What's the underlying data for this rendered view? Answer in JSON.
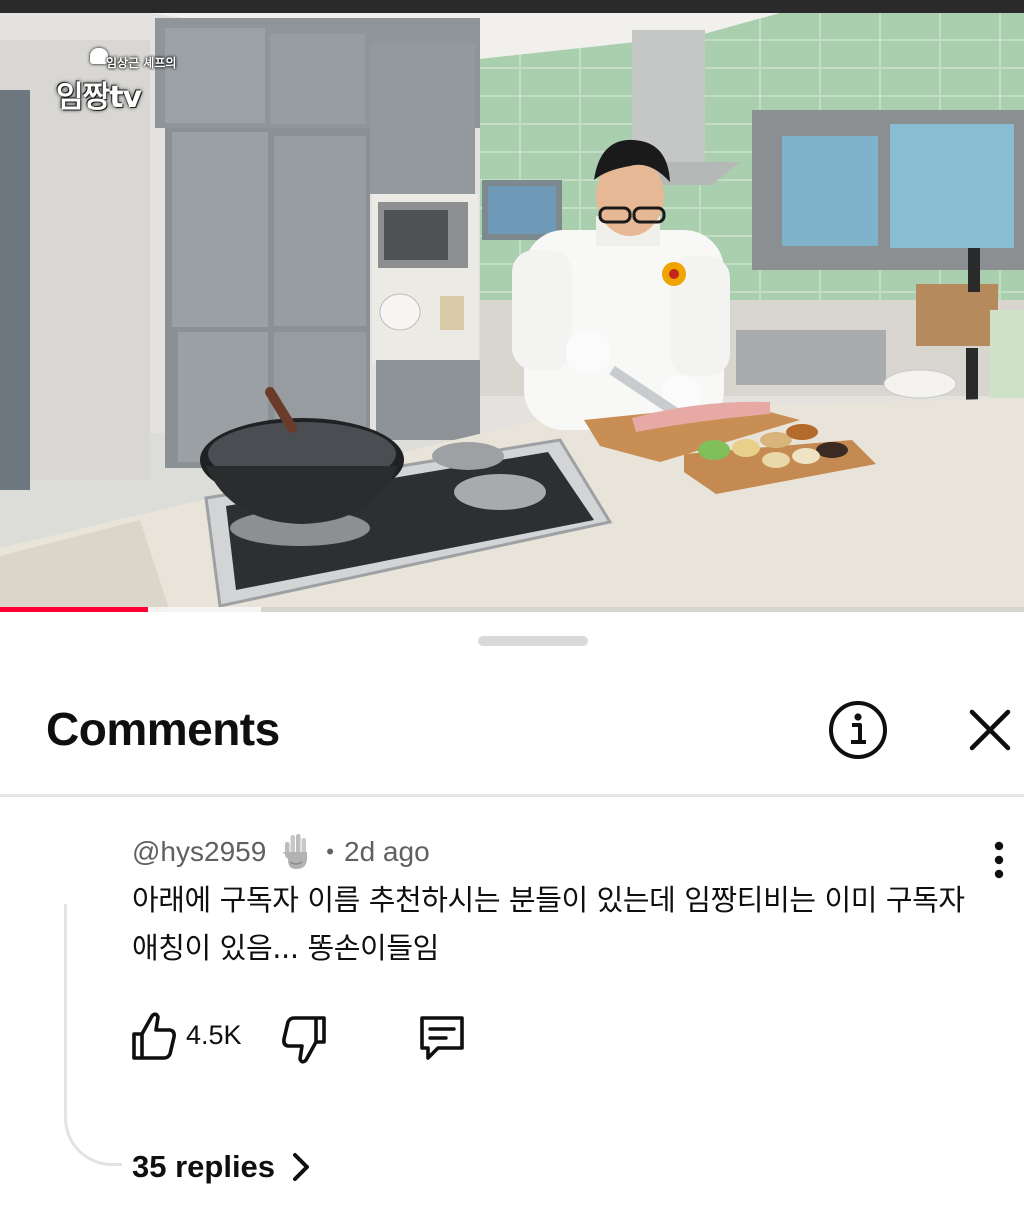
{
  "video": {
    "channel_logo_sub": "임상근 셰프의",
    "channel_logo_main": "임짱tv",
    "progress_percent": 14.5,
    "buffer_percent": 25.5,
    "colors": {
      "progress": "#ff0033"
    }
  },
  "sheet": {
    "title": "Comments",
    "info_icon": "info-circle-icon",
    "close_icon": "close-icon"
  },
  "comment": {
    "author": "@hys2959",
    "badge_icon": "raised-hand-icon",
    "separator": "•",
    "time": "2d ago",
    "text": "아래에 구독자 이름 추천하시는 분들이 있는데 임짱티비는 이미 구독자 애칭이 있음... 똥손이들임",
    "like_count": "4.5K",
    "like_icon": "thumbs-up-icon",
    "dislike_icon": "thumbs-down-icon",
    "reply_icon": "reply-comment-icon",
    "more_icon": "more-vertical-icon",
    "replies_label": "35 replies",
    "replies_icon": "chevron-right-icon"
  }
}
